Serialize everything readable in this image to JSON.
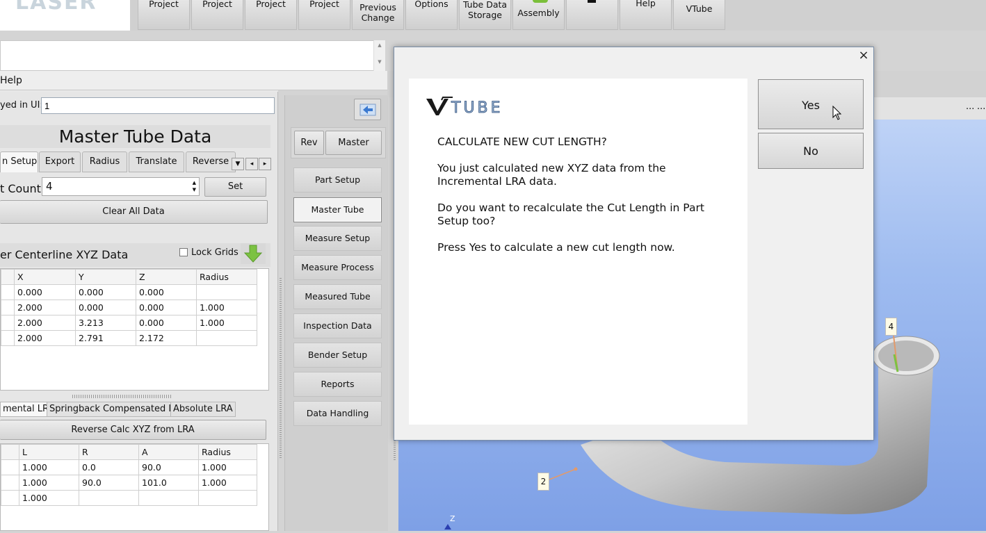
{
  "toolbar": {
    "logo_text": "LASER",
    "buttons": [
      {
        "label": "Load Project"
      },
      {
        "label": "Save Project"
      },
      {
        "label": "Save As... Project"
      },
      {
        "label": "Clear Project"
      },
      {
        "label": "Previous Change"
      },
      {
        "label": "System Options"
      },
      {
        "label": "Tube Data Storage"
      },
      {
        "label": "Assembly"
      },
      {
        "label": ""
      },
      {
        "label": "Help"
      },
      {
        "label": "VTube"
      }
    ]
  },
  "menubar": {
    "help": "Help"
  },
  "left": {
    "ui_label": "yed in UI:",
    "ui_value": "1",
    "title": "Master Tube Data",
    "tabs": [
      "n Setup",
      "Export",
      "Radius",
      "Translate",
      "Reverse"
    ],
    "point_count_label": "t Count",
    "point_count_value": "4",
    "set_button": "Set",
    "clear_button": "Clear All Data",
    "xyz_title": "er Centerline XYZ Data",
    "lock_grids": "Lock Grids",
    "xyz_headers": [
      "",
      "X",
      "Y",
      "Z",
      "Radius"
    ],
    "xyz_rows": [
      [
        "",
        "0.000",
        "0.000",
        "0.000",
        ""
      ],
      [
        "",
        "2.000",
        "0.000",
        "0.000",
        "1.000"
      ],
      [
        "",
        "2.000",
        "3.213",
        "0.000",
        "1.000"
      ],
      [
        "",
        "2.000",
        "2.791",
        "2.172",
        ""
      ]
    ],
    "lra_tabs": [
      "mental LRA",
      "Springback Compensated LRA",
      "Absolute LRA"
    ],
    "reverse_button": "Reverse Calc XYZ from LRA",
    "lra_headers": [
      "",
      "L",
      "R",
      "A",
      "Radius"
    ],
    "lra_rows": [
      [
        "",
        "1.000",
        "0.0",
        "90.0",
        "1.000"
      ],
      [
        "",
        "1.000",
        "90.0",
        "101.0",
        "1.000"
      ],
      [
        "",
        "1.000",
        "",
        "",
        ""
      ]
    ]
  },
  "nav": {
    "rev": "Rev",
    "master": "Master",
    "items": [
      "Part Setup",
      "Master Tube",
      "Measure Setup",
      "Measure Process",
      "Measured Tube",
      "Inspection Data",
      "Bender Setup",
      "Reports",
      "Data Handling"
    ]
  },
  "view": {
    "label_4": "4",
    "label_2": "2",
    "axis_z": "Z",
    "dots": "..."
  },
  "dialog": {
    "logo": "VTUBE",
    "heading": "CALCULATE NEW CUT LENGTH?",
    "p1": "You just calculated new XYZ data from the Incremental LRA data.",
    "p2": "Do you want to recalculate the Cut Length in Part Setup too?",
    "p3": "Press Yes to calculate a new cut length now.",
    "yes": "Yes",
    "no": "No",
    "close": "×"
  },
  "colors": {
    "accent_green": "#6db33f",
    "view_blue": "#9fbcf0",
    "tube": "#d8d8d8"
  }
}
